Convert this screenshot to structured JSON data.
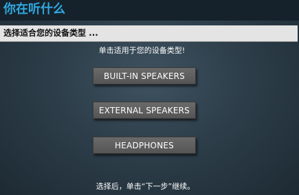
{
  "window": {
    "title": "你在听什么"
  },
  "header": {
    "label": "选择适合您的设备类型 ..."
  },
  "instruction": "单击适用于您的设备类型!",
  "options": [
    {
      "label": "BUILT-IN SPEAKERS"
    },
    {
      "label": "EXTERNAL SPEAKERS"
    },
    {
      "label": "HEADPHONES"
    }
  ],
  "footer": "选择后，单击“下一步”继续。",
  "colors": {
    "title": "#2fa8e0",
    "title_bar": "#16222b",
    "background": "#2d3e4a",
    "header_strip": "#e4e4e4",
    "button": "#5f5f5f",
    "text": "#ffffff"
  }
}
